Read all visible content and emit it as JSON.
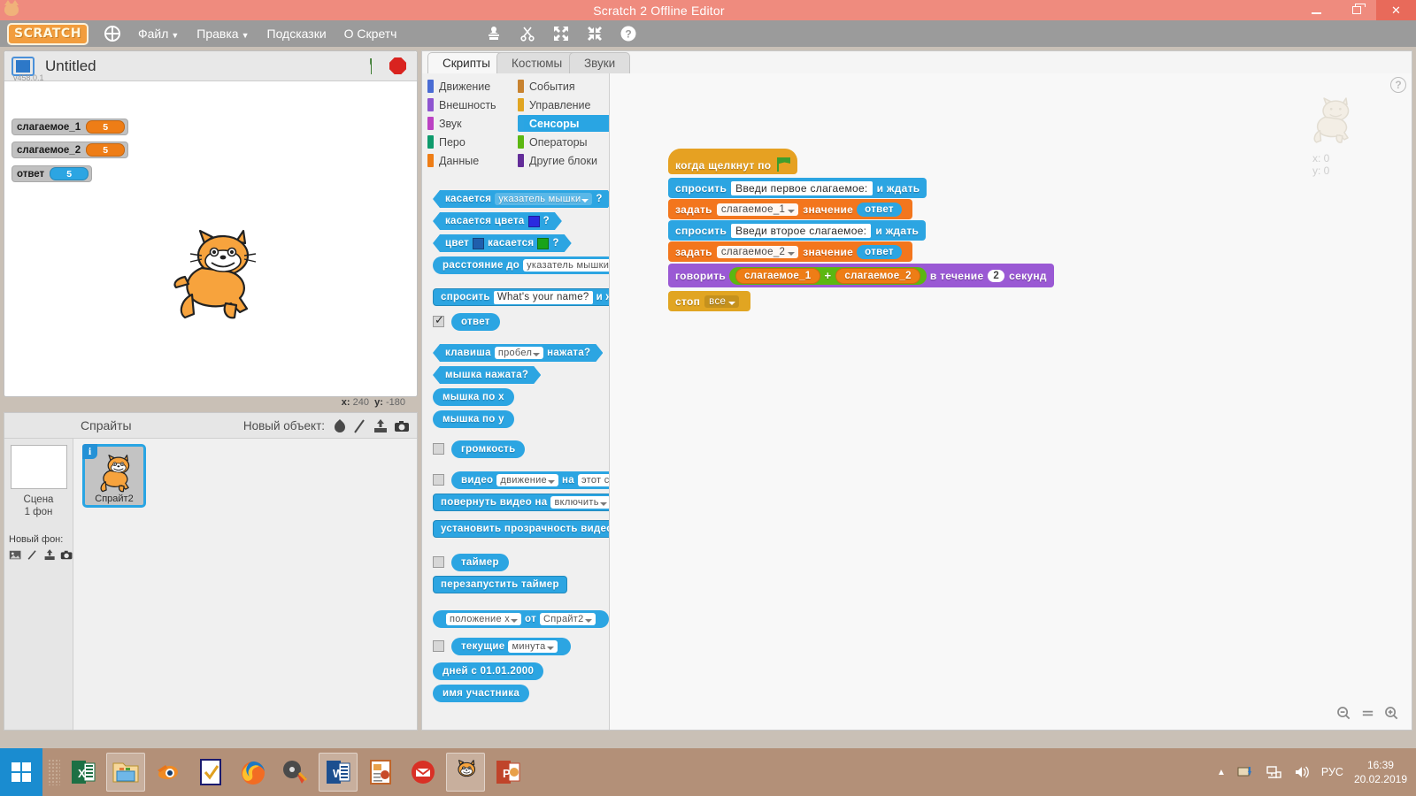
{
  "window": {
    "title": "Scratch 2 Offline Editor",
    "minimize": "–",
    "restore": "❐",
    "close": "✕"
  },
  "menubar": {
    "logo": "SCRATCH",
    "globe_icon": "globe-icon",
    "items": [
      {
        "label": "Файл",
        "caret": "▼"
      },
      {
        "label": "Правка",
        "caret": "▼"
      },
      {
        "label": "Подсказки",
        "caret": ""
      },
      {
        "label": "О Скретч",
        "caret": ""
      }
    ],
    "tools": [
      "stamp-icon",
      "scissors-icon",
      "grow-icon",
      "shrink-icon",
      "help-icon"
    ]
  },
  "stage": {
    "project_title": "Untitled",
    "version": "v458.0.1",
    "green_flag": "green-flag-icon",
    "stop": "stop-icon",
    "watchers": [
      {
        "label": "слагаемое_1",
        "value": "5",
        "color": "#ee7d16"
      },
      {
        "label": "слагаемое_2",
        "value": "5",
        "color": "#ee7d16"
      },
      {
        "label": "ответ",
        "value": "5",
        "color": "#2ca5e2"
      }
    ],
    "coords": {
      "x_label": "x:",
      "x_value": "240",
      "y_label": "y:",
      "y_value": "-180"
    }
  },
  "sprite_pane": {
    "title": "Спрайты",
    "new_object_label": "Новый объект:",
    "new_object_icons": [
      "paint-brush-icon",
      "choose-sprite-icon",
      "upload-sprite-icon",
      "camera-icon"
    ],
    "stage_thumb_label": "Сцена",
    "stage_thumb_sub": "1 фон",
    "new_backdrop_label": "Новый фон:",
    "new_backdrop_icons": [
      "choose-backdrop-icon",
      "paint-backdrop-icon",
      "upload-backdrop-icon",
      "camera-backdrop-icon"
    ],
    "sprites": [
      {
        "name": "Спрайт2",
        "info": "i",
        "selected": true
      }
    ]
  },
  "editor": {
    "tabs": [
      {
        "label": "Скрипты",
        "active": true
      },
      {
        "label": "Костюмы",
        "active": false
      },
      {
        "label": "Звуки",
        "active": false
      }
    ],
    "categories": [
      {
        "label": "Движение",
        "color": "#4a6cd4",
        "selected": false
      },
      {
        "label": "События",
        "color": "#c88330",
        "selected": false
      },
      {
        "label": "Внешность",
        "color": "#8e55d0",
        "selected": false
      },
      {
        "label": "Управление",
        "color": "#e1a522",
        "selected": false
      },
      {
        "label": "Звук",
        "color": "#bb42c3",
        "selected": false
      },
      {
        "label": "Сенсоры",
        "color": "#2ca5e2",
        "selected": true
      },
      {
        "label": "Перо",
        "color": "#0e9a6c",
        "selected": false
      },
      {
        "label": "Операторы",
        "color": "#5cb712",
        "selected": false
      },
      {
        "label": "Данные",
        "color": "#ee7d16",
        "selected": false
      },
      {
        "label": "Другие блоки",
        "color": "#632d99",
        "selected": false
      }
    ],
    "palette_blocks": [
      {
        "id": "touching",
        "shape": "bool",
        "parts": [
          {
            "t": "label",
            "v": "касается"
          },
          {
            "t": "drop",
            "v": "указатель мышки"
          },
          {
            "t": "label",
            "v": "?"
          }
        ]
      },
      {
        "id": "touching-color",
        "shape": "bool",
        "parts": [
          {
            "t": "label",
            "v": "касается цвета"
          },
          {
            "t": "color",
            "v": "#2a2ae0"
          },
          {
            "t": "label",
            "v": "?"
          }
        ]
      },
      {
        "id": "color-touching",
        "shape": "bool",
        "parts": [
          {
            "t": "label",
            "v": "цвет"
          },
          {
            "t": "color",
            "v": "#1f5fad"
          },
          {
            "t": "label",
            "v": "касается"
          },
          {
            "t": "color",
            "v": "#19a319"
          },
          {
            "t": "label",
            "v": "?"
          }
        ]
      },
      {
        "id": "distance-to",
        "shape": "report",
        "parts": [
          {
            "t": "label",
            "v": "расстояние до"
          },
          {
            "t": "drop-white",
            "v": "указатель мышки"
          }
        ]
      },
      {
        "id": "ask-and-wait",
        "shape": "stack",
        "parts": [
          {
            "t": "label",
            "v": "спросить"
          },
          {
            "t": "text",
            "v": "What's your name?"
          },
          {
            "t": "label",
            "v": "и ждать"
          }
        ]
      },
      {
        "id": "answer",
        "shape": "report",
        "checkbox": "checked",
        "parts": [
          {
            "t": "label",
            "v": "ответ"
          }
        ]
      },
      {
        "id": "key-pressed",
        "shape": "bool",
        "parts": [
          {
            "t": "label",
            "v": "клавиша"
          },
          {
            "t": "drop-white",
            "v": "пробел"
          },
          {
            "t": "label",
            "v": "нажата?"
          }
        ]
      },
      {
        "id": "mouse-down",
        "shape": "bool",
        "parts": [
          {
            "t": "label",
            "v": "мышка нажата?"
          }
        ]
      },
      {
        "id": "mouse-x",
        "shape": "report",
        "parts": [
          {
            "t": "label",
            "v": "мышка по x"
          }
        ]
      },
      {
        "id": "mouse-y",
        "shape": "report",
        "parts": [
          {
            "t": "label",
            "v": "мышка по y"
          }
        ]
      },
      {
        "id": "loudness",
        "shape": "report",
        "checkbox": "unchecked",
        "parts": [
          {
            "t": "label",
            "v": "громкость"
          }
        ]
      },
      {
        "id": "video-on",
        "shape": "report",
        "checkbox": "unchecked",
        "parts": [
          {
            "t": "label",
            "v": "видео"
          },
          {
            "t": "drop-white",
            "v": "движение"
          },
          {
            "t": "label",
            "v": "на"
          },
          {
            "t": "drop-white",
            "v": "этот спр"
          }
        ]
      },
      {
        "id": "turn-video",
        "shape": "stack",
        "parts": [
          {
            "t": "label",
            "v": "повернуть видео на"
          },
          {
            "t": "drop-white",
            "v": "включить"
          }
        ]
      },
      {
        "id": "video-transp",
        "shape": "stack",
        "parts": [
          {
            "t": "label",
            "v": "установить прозрачность видео"
          }
        ]
      },
      {
        "id": "timer",
        "shape": "report",
        "checkbox": "unchecked",
        "parts": [
          {
            "t": "label",
            "v": "таймер"
          }
        ]
      },
      {
        "id": "reset-timer",
        "shape": "stack",
        "parts": [
          {
            "t": "label",
            "v": "перезапустить таймер"
          }
        ]
      },
      {
        "id": "attribute-of",
        "shape": "report",
        "parts": [
          {
            "t": "drop-white",
            "v": "положение x"
          },
          {
            "t": "label",
            "v": "от"
          },
          {
            "t": "drop-white",
            "v": "Спрайт2"
          }
        ]
      },
      {
        "id": "current",
        "shape": "report",
        "checkbox": "unchecked",
        "parts": [
          {
            "t": "label",
            "v": "текущие"
          },
          {
            "t": "drop-white",
            "v": "минута"
          }
        ]
      },
      {
        "id": "days-since",
        "shape": "report",
        "parts": [
          {
            "t": "label",
            "v": "дней с 01.01.2000"
          }
        ]
      },
      {
        "id": "username",
        "shape": "report",
        "parts": [
          {
            "t": "label",
            "v": "имя участника"
          }
        ]
      }
    ],
    "script": {
      "blocks": [
        {
          "id": "when-flag-clicked",
          "kind": "events",
          "parts": [
            {
              "t": "label",
              "v": "когда щелкнут по"
            },
            {
              "t": "flag",
              "v": "green-flag-icon"
            }
          ]
        },
        {
          "id": "ask-1",
          "kind": "sensing",
          "parts": [
            {
              "t": "label",
              "v": "спросить"
            },
            {
              "t": "text",
              "v": "Введи первое слагаемое:"
            },
            {
              "t": "label",
              "v": "и ждать"
            }
          ]
        },
        {
          "id": "set-var-1",
          "kind": "data",
          "parts": [
            {
              "t": "label",
              "v": "задать"
            },
            {
              "t": "drop",
              "v": "слагаемое_1"
            },
            {
              "t": "label",
              "v": "значение"
            },
            {
              "t": "report",
              "v": "ответ"
            }
          ]
        },
        {
          "id": "ask-2",
          "kind": "sensing",
          "parts": [
            {
              "t": "label",
              "v": "спросить"
            },
            {
              "t": "text",
              "v": "Введи второе слагаемое:"
            },
            {
              "t": "label",
              "v": "и ждать"
            }
          ]
        },
        {
          "id": "set-var-2",
          "kind": "data",
          "parts": [
            {
              "t": "label",
              "v": "задать"
            },
            {
              "t": "drop",
              "v": "слагаемое_2"
            },
            {
              "t": "label",
              "v": "значение"
            },
            {
              "t": "report",
              "v": "ответ"
            }
          ]
        },
        {
          "id": "say-for-secs",
          "kind": "looks",
          "parts": [
            {
              "t": "label",
              "v": "говорить"
            },
            {
              "t": "op",
              "v": "+",
              "a": "слагаемое_1",
              "b": "слагаемое_2"
            },
            {
              "t": "label",
              "v": "в течение"
            },
            {
              "t": "num",
              "v": "2"
            },
            {
              "t": "label",
              "v": "секунд"
            }
          ]
        },
        {
          "id": "stop-all",
          "kind": "control",
          "parts": [
            {
              "t": "label",
              "v": "стоп"
            },
            {
              "t": "drop",
              "v": "все"
            }
          ]
        }
      ]
    },
    "watermark": {
      "x_label": "x: 0",
      "y_label": "y: 0",
      "icon": "cat-watermark-icon"
    },
    "help_button": "?",
    "zoom_controls": [
      "zoom-out-icon",
      "zoom-reset-icon",
      "zoom-in-icon"
    ]
  },
  "taskbar": {
    "start": "windows-start-icon",
    "apps": [
      {
        "name": "excel-icon",
        "active": false
      },
      {
        "name": "file-explorer-icon",
        "active": true
      },
      {
        "name": "blender-icon",
        "active": false
      },
      {
        "name": "checkmark-app-icon",
        "active": false
      },
      {
        "name": "firefox-icon",
        "active": false
      },
      {
        "name": "media-player-icon",
        "active": false
      },
      {
        "name": "word-icon",
        "active": true
      },
      {
        "name": "publisher-icon",
        "active": false
      },
      {
        "name": "mail-icon",
        "active": false
      },
      {
        "name": "scratch-icon",
        "active": true
      },
      {
        "name": "powerpoint-icon",
        "active": false
      }
    ],
    "tray": {
      "show_hidden": "▲",
      "icons": [
        "update-icon",
        "network-icon",
        "volume-icon"
      ],
      "language": "РУС",
      "time": "16:39",
      "date": "20.02.2019"
    }
  }
}
